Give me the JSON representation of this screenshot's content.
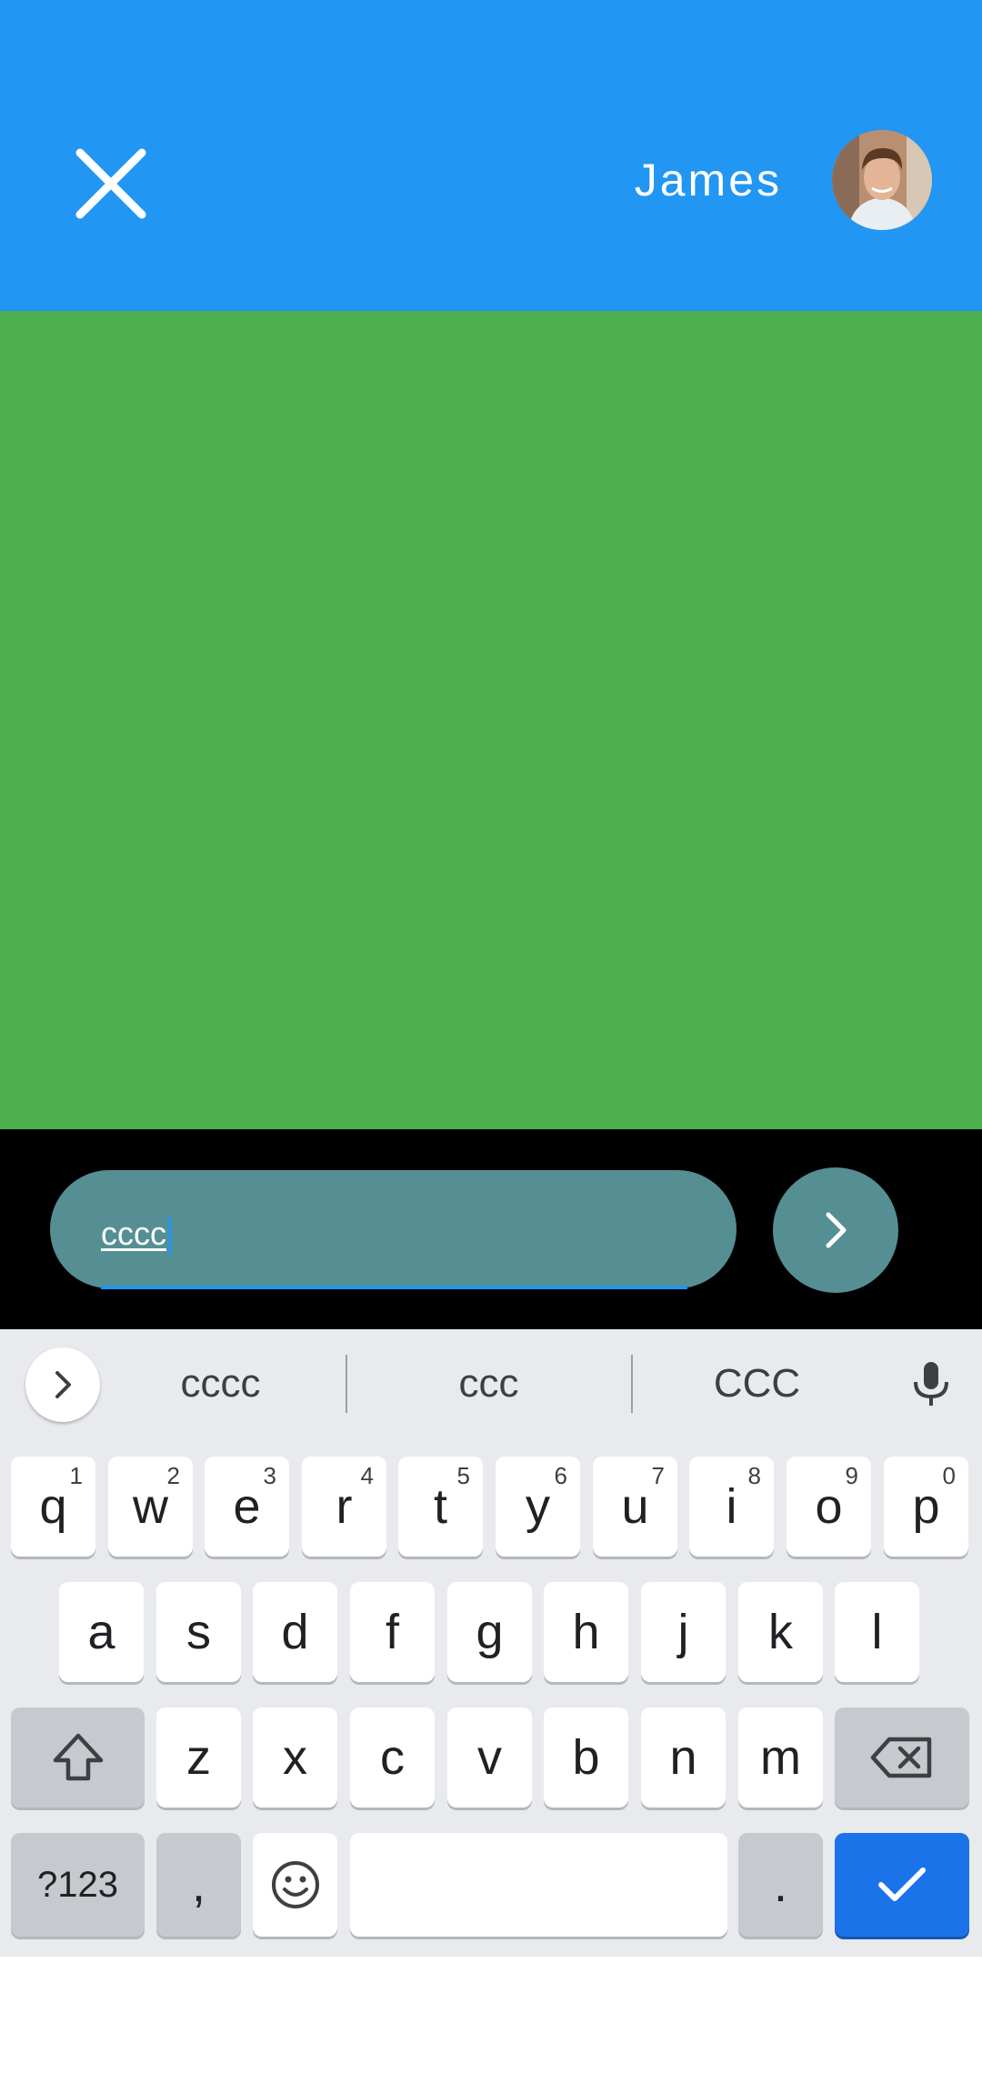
{
  "header": {
    "name": "James",
    "colors": {
      "background": "#2196F3",
      "text": "#FFFFFF"
    },
    "icons": {
      "close": "close-icon",
      "avatar": "avatar-photo"
    }
  },
  "content": {
    "background": "#4CAF50"
  },
  "composer": {
    "value": "cccc",
    "send_icon": "chevron-right-icon",
    "colors": {
      "pill": "#558F94",
      "caret": "#2196F3"
    }
  },
  "keyboard": {
    "suggestions": [
      "cccc",
      "ccc",
      "CCC"
    ],
    "expand_icon": "chevron-right-icon",
    "mic_icon": "microphone-icon",
    "row1": [
      {
        "key": "q",
        "hint": "1"
      },
      {
        "key": "w",
        "hint": "2"
      },
      {
        "key": "e",
        "hint": "3"
      },
      {
        "key": "r",
        "hint": "4"
      },
      {
        "key": "t",
        "hint": "5"
      },
      {
        "key": "y",
        "hint": "6"
      },
      {
        "key": "u",
        "hint": "7"
      },
      {
        "key": "i",
        "hint": "8"
      },
      {
        "key": "o",
        "hint": "9"
      },
      {
        "key": "p",
        "hint": "0"
      }
    ],
    "row2": [
      "a",
      "s",
      "d",
      "f",
      "g",
      "h",
      "j",
      "k",
      "l"
    ],
    "row3": [
      "z",
      "x",
      "c",
      "v",
      "b",
      "n",
      "m"
    ],
    "row4": {
      "symbols": "?123",
      "comma": ",",
      "period": "."
    },
    "icons": {
      "shift": "shift-icon",
      "backspace": "backspace-icon",
      "emoji": "emoji-icon",
      "enter": "checkmark-icon"
    },
    "colors": {
      "background": "#E8EAED",
      "key": "#FFFFFF",
      "dark_key": "#C6C9CE",
      "enter": "#1A73E8"
    }
  }
}
